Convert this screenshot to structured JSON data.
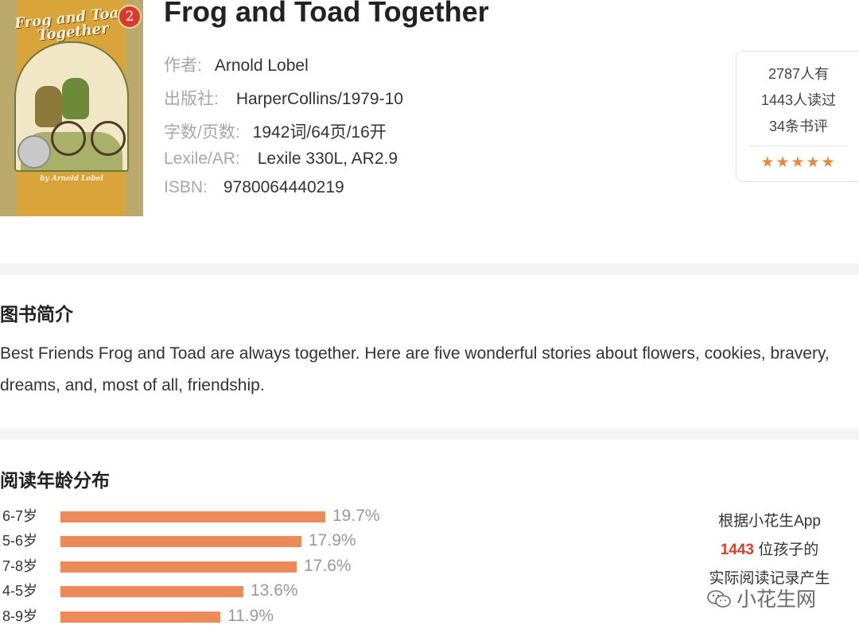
{
  "book": {
    "title": "Frog and Toad Together",
    "cover": {
      "series_number": "2",
      "title_art": "Frog and Toad Together",
      "author_art": "by Arnold Lobel"
    },
    "meta": [
      {
        "key": "作者:",
        "value": "Arnold Lobel"
      },
      {
        "key": "出版社:",
        "value": "HarperCollins/1979-10"
      },
      {
        "key": "字数/页数:",
        "value": "1942词/64页/16开"
      },
      {
        "key": "Lexile/AR:",
        "value": "Lexile 330L, AR2.9"
      },
      {
        "key": "ISBN:",
        "value": "9780064440219"
      }
    ]
  },
  "stats": {
    "have": "2787人有",
    "read": "1443人读过",
    "reviews": "34条书评",
    "stars": "★★★★★",
    "rating_stars": 5
  },
  "intro": {
    "title": "图书简介",
    "text": "Best Friends Frog and Toad are always together. Here are five wonderful stories about flowers, cookies, bravery, dreams, and, most of all, friendship."
  },
  "age_distribution": {
    "title": "阅读年龄分布",
    "bar_color": "#ec8a5a",
    "rows": [
      {
        "age": "6-7岁",
        "percent": 19.7,
        "label": "19.7%"
      },
      {
        "age": "5-6岁",
        "percent": 17.9,
        "label": "17.9%"
      },
      {
        "age": "7-8岁",
        "percent": 17.6,
        "label": "17.6%"
      },
      {
        "age": "4-5岁",
        "percent": 13.6,
        "label": "13.6%"
      },
      {
        "age": "8-9岁",
        "percent": 11.9,
        "label": "11.9%"
      }
    ],
    "note": {
      "line1": "根据小花生App",
      "count": "1443",
      "line2_suffix": " 位孩子的",
      "line3": "实际阅读记录产生"
    }
  },
  "watermark": {
    "icon": "wechat-icon",
    "text": "小花生网"
  },
  "colors": {
    "accent": "#d8402e",
    "star": "#e68a3a",
    "bar": "#ec8a5a"
  }
}
